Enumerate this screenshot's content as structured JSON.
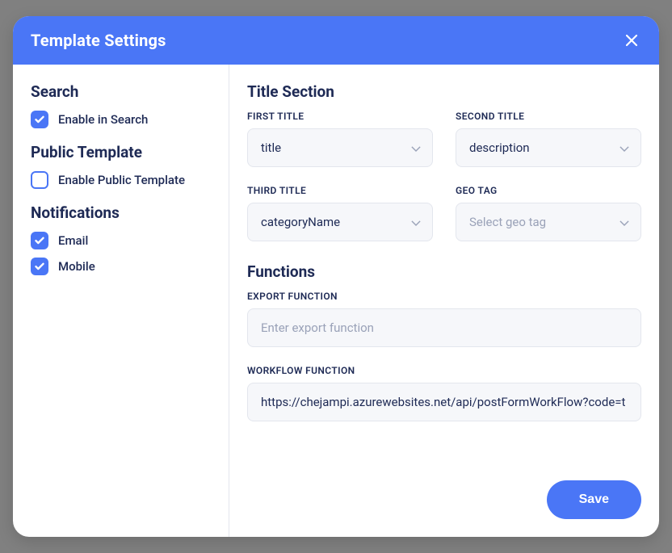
{
  "header": {
    "title": "Template Settings"
  },
  "sidebar": {
    "search": {
      "title": "Search",
      "enable_label": "Enable in Search",
      "enabled": true
    },
    "public_template": {
      "title": "Public Template",
      "enable_label": "Enable Public Template",
      "enabled": false
    },
    "notifications": {
      "title": "Notifications",
      "email_label": "Email",
      "email_enabled": true,
      "mobile_label": "Mobile",
      "mobile_enabled": true
    }
  },
  "main": {
    "title_section": {
      "title": "Title Section",
      "first_title_label": "FIRST TITLE",
      "first_title_value": "title",
      "second_title_label": "SECOND TITLE",
      "second_title_value": "description",
      "third_title_label": "THIRD TITLE",
      "third_title_value": "categoryName",
      "geo_tag_label": "GEO TAG",
      "geo_tag_placeholder": "Select geo tag"
    },
    "functions": {
      "title": "Functions",
      "export_label": "EXPORT FUNCTION",
      "export_placeholder": "Enter export function",
      "export_value": "",
      "workflow_label": "WORKFLOW FUNCTION",
      "workflow_value": "https://chejampi.azurewebsites.net/api/postFormWorkFlow?code=t"
    }
  },
  "footer": {
    "save_label": "Save"
  }
}
